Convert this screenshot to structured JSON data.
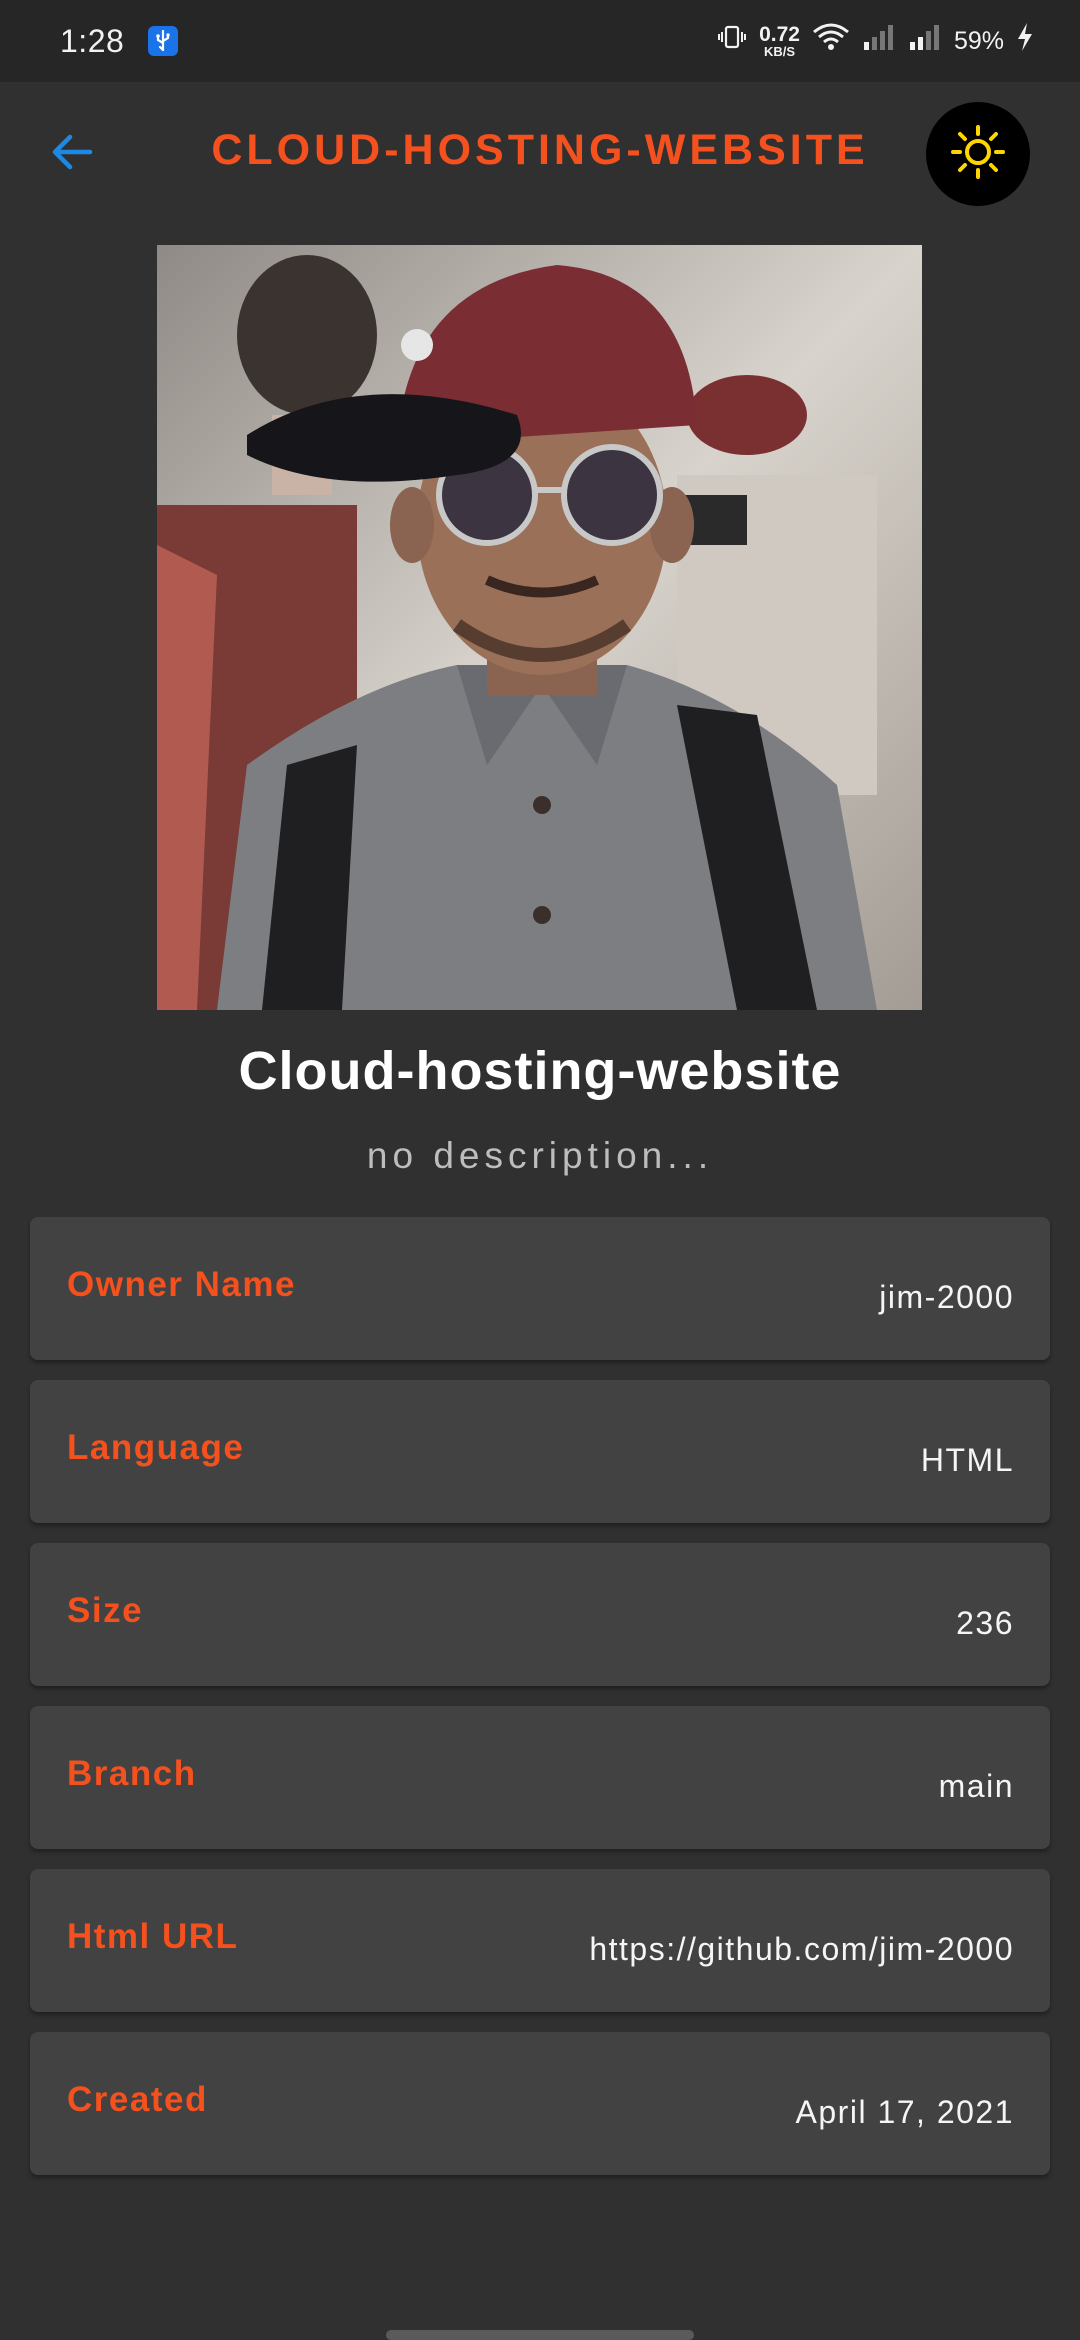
{
  "status_bar": {
    "time": "1:28",
    "net_speed_value": "0.72",
    "net_speed_unit": "KB/S",
    "battery": "59%"
  },
  "app_bar": {
    "title": "CLOUD-HOSTING-WEBSITE",
    "back_icon": "arrow-back-icon",
    "theme_icon": "sun-icon",
    "accent_color": "#f4511e",
    "back_color": "#1e88e5"
  },
  "repo": {
    "name": "Cloud-hosting-website",
    "description": "no description..."
  },
  "details": [
    {
      "label": "Owner Name",
      "value": "jim-2000"
    },
    {
      "label": "Language",
      "value": "HTML"
    },
    {
      "label": "Size",
      "value": "236"
    },
    {
      "label": "Branch",
      "value": "main"
    },
    {
      "label": "Html URL",
      "value": "https://github.com/jim-2000"
    },
    {
      "label": "Created",
      "value": "April 17, 2021"
    }
  ]
}
